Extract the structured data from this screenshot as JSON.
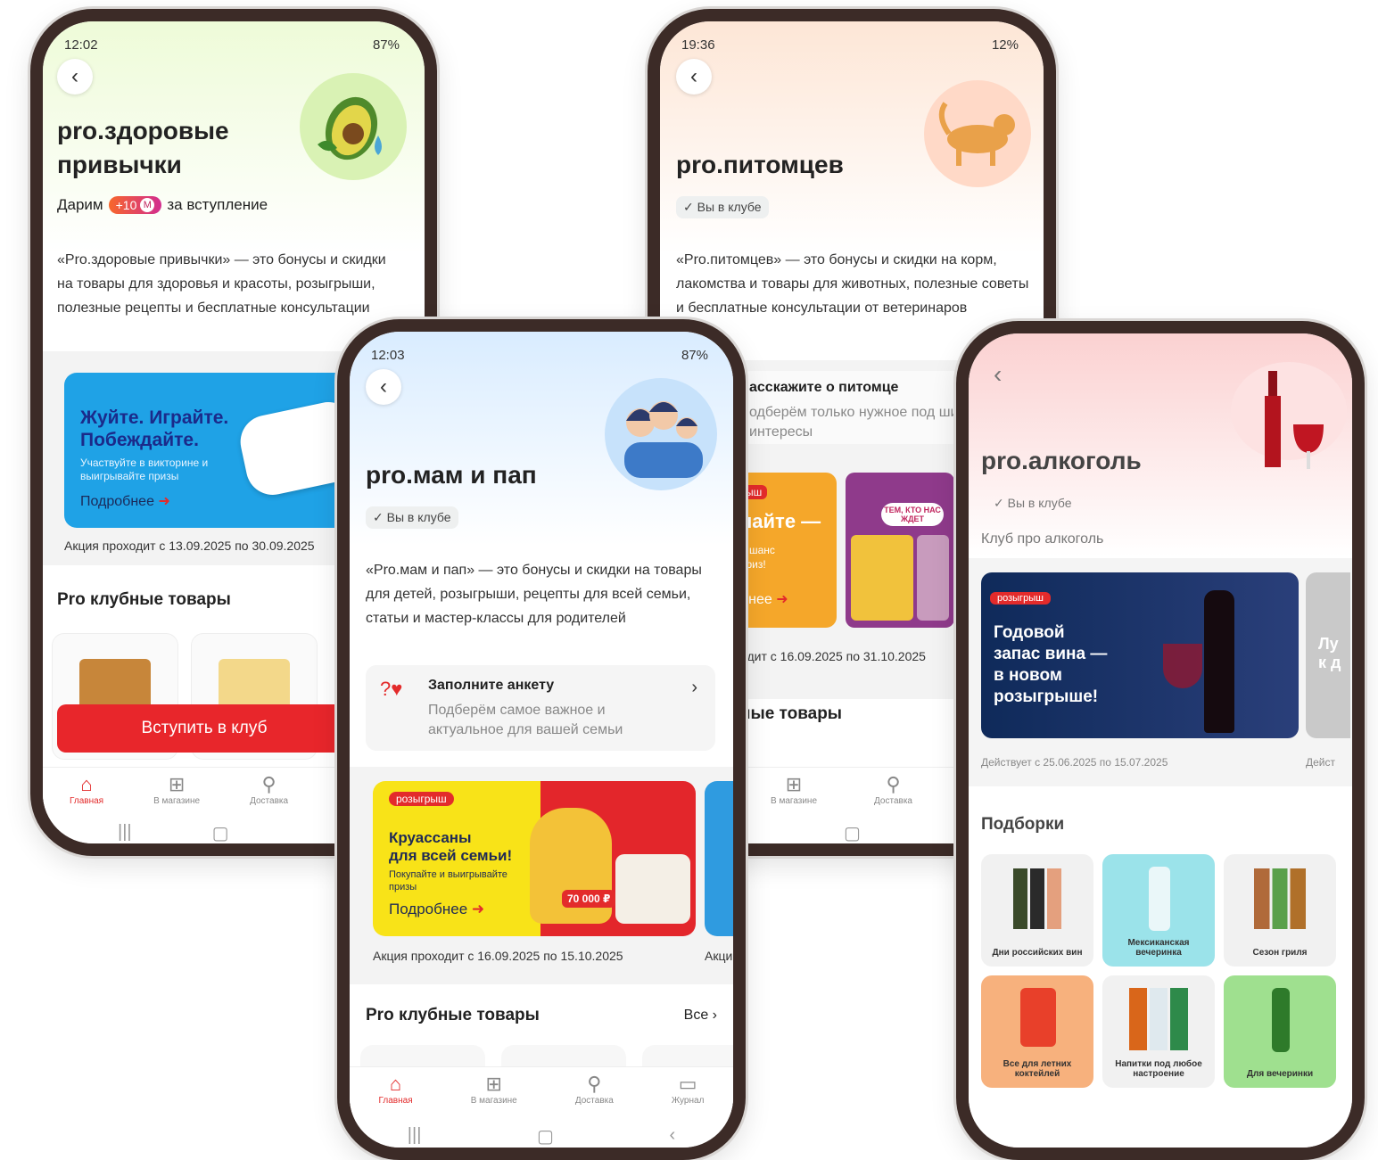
{
  "phone1": {
    "status_time": "12:02",
    "status_right": "87%",
    "title_line1": "pro.здоровые",
    "title_line2": "привычки",
    "bonus_prefix": "Дарим",
    "bonus_value": "+10",
    "bonus_suffix": "за вступление",
    "description": "«Pro.здоровые привычки» — это бонусы и скидки на товары для здоровья и красоты, розыгрыши, полезные рецепты и бесплатные консультации",
    "promo_line1": "Жуйте. Играйте.",
    "promo_line2": "Побеждайте.",
    "promo_sub": "Участвуйте в викторине и выигрывайте призы",
    "promo_more": "Подробнее",
    "promo_caption": "Акция проходит с 13.09.2025 по 30.09.2025",
    "section_title": "Pro клубные товары",
    "join_button": "Вступить в клуб",
    "tabs": [
      "Главная",
      "В магазине",
      "Доставка"
    ]
  },
  "phone2": {
    "status_time": "19:36",
    "status_right": "12%",
    "title": "pro.питомцев",
    "chip": "Вы в клубе",
    "description": "«Pro.питомцев» — это бонусы и скидки на корм, лакомства и товары для животных, полезные советы и бесплатные консультации от ветеринаров",
    "survey_title": "асскажите о питомце",
    "survey_sub": "одберём только нужное под ши интересы",
    "promo_word": "пайте —",
    "promo_sub1": "е шанс",
    "promo_sub2": "приз!",
    "promo_more": "бнее",
    "promo_badge": "ыш",
    "promo2_text": "ТЕМ, КТО НАС ЖДЕТ",
    "promo_caption": "одит с 16.09.2025 по 31.10.2025",
    "section_title": "ные товары",
    "tabs": [
      "В магазине",
      "Доставка"
    ]
  },
  "phone3": {
    "status_time": "12:03",
    "status_right": "87%",
    "title": "pro.мам и пап",
    "chip": "Вы в клубе",
    "description": "«Pro.мам и пап» — это бонусы и скидки на товары для детей, розыгрыши, рецепты для всей семьи, статьи и мастер-классы для родителей",
    "survey_title": "Заполните анкету",
    "survey_sub": "Подберём самое важное и актуальное для вашей семьи",
    "promo_badge": "розыгрыш",
    "promo_line1": "Круассаны",
    "promo_line2": "для всей семьи!",
    "promo_sub": "Покупайте и выигрывайте призы",
    "promo_more": "Подробнее",
    "promo_prize": "70 000 ₽",
    "promo_caption": "Акция проходит с 16.09.2025 по 15.10.2025",
    "promo_caption2": "Акци",
    "section_title": "Pro клубные товары",
    "section_all": "Все",
    "tabs": [
      "Главная",
      "В магазине",
      "Доставка",
      "Журнал"
    ]
  },
  "phone4": {
    "title": "pro.алкоголь",
    "chip": "Вы в клубе",
    "subtitle": "Клуб про алкоголь",
    "promo_badge": "розыгрыш",
    "promo_line1": "Годовой",
    "promo_line2": "запас вина —",
    "promo_line3": "в новом",
    "promo_line4": "розыгрыше!",
    "promo_caption": "Действует с 25.06.2025 по 15.07.2025",
    "promo_caption2": "Дейст",
    "promo_side": "Лу к д",
    "section_title": "Подборки",
    "collections": [
      {
        "label": "Дни российских вин",
        "color": "#f1f1f1"
      },
      {
        "label": "Мексиканская вечеринка",
        "color": "#9be3ea"
      },
      {
        "label": "Сезон гриля",
        "color": "#f1f1f1"
      },
      {
        "label": "Все для летних коктейлей",
        "color": "#f7b17d"
      },
      {
        "label": "Напитки под любое настроение",
        "color": "#f1f1f1"
      },
      {
        "label": "Для вечеринки",
        "color": "#9fe08f"
      }
    ]
  }
}
